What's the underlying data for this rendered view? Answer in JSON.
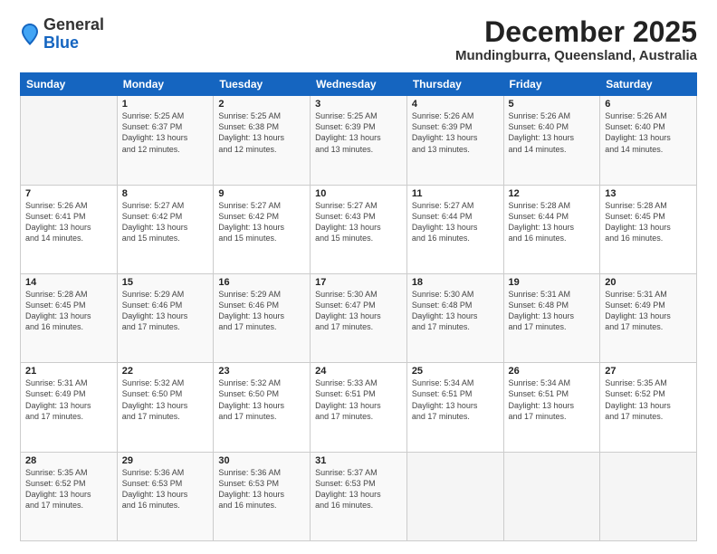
{
  "header": {
    "logo_general": "General",
    "logo_blue": "Blue",
    "month_title": "December 2025",
    "location": "Mundingburra, Queensland, Australia"
  },
  "days_of_week": [
    "Sunday",
    "Monday",
    "Tuesday",
    "Wednesday",
    "Thursday",
    "Friday",
    "Saturday"
  ],
  "weeks": [
    [
      {
        "day": "",
        "info": ""
      },
      {
        "day": "1",
        "info": "Sunrise: 5:25 AM\nSunset: 6:37 PM\nDaylight: 13 hours\nand 12 minutes."
      },
      {
        "day": "2",
        "info": "Sunrise: 5:25 AM\nSunset: 6:38 PM\nDaylight: 13 hours\nand 12 minutes."
      },
      {
        "day": "3",
        "info": "Sunrise: 5:25 AM\nSunset: 6:39 PM\nDaylight: 13 hours\nand 13 minutes."
      },
      {
        "day": "4",
        "info": "Sunrise: 5:26 AM\nSunset: 6:39 PM\nDaylight: 13 hours\nand 13 minutes."
      },
      {
        "day": "5",
        "info": "Sunrise: 5:26 AM\nSunset: 6:40 PM\nDaylight: 13 hours\nand 14 minutes."
      },
      {
        "day": "6",
        "info": "Sunrise: 5:26 AM\nSunset: 6:40 PM\nDaylight: 13 hours\nand 14 minutes."
      }
    ],
    [
      {
        "day": "7",
        "info": "Sunrise: 5:26 AM\nSunset: 6:41 PM\nDaylight: 13 hours\nand 14 minutes."
      },
      {
        "day": "8",
        "info": "Sunrise: 5:27 AM\nSunset: 6:42 PM\nDaylight: 13 hours\nand 15 minutes."
      },
      {
        "day": "9",
        "info": "Sunrise: 5:27 AM\nSunset: 6:42 PM\nDaylight: 13 hours\nand 15 minutes."
      },
      {
        "day": "10",
        "info": "Sunrise: 5:27 AM\nSunset: 6:43 PM\nDaylight: 13 hours\nand 15 minutes."
      },
      {
        "day": "11",
        "info": "Sunrise: 5:27 AM\nSunset: 6:44 PM\nDaylight: 13 hours\nand 16 minutes."
      },
      {
        "day": "12",
        "info": "Sunrise: 5:28 AM\nSunset: 6:44 PM\nDaylight: 13 hours\nand 16 minutes."
      },
      {
        "day": "13",
        "info": "Sunrise: 5:28 AM\nSunset: 6:45 PM\nDaylight: 13 hours\nand 16 minutes."
      }
    ],
    [
      {
        "day": "14",
        "info": "Sunrise: 5:28 AM\nSunset: 6:45 PM\nDaylight: 13 hours\nand 16 minutes."
      },
      {
        "day": "15",
        "info": "Sunrise: 5:29 AM\nSunset: 6:46 PM\nDaylight: 13 hours\nand 17 minutes."
      },
      {
        "day": "16",
        "info": "Sunrise: 5:29 AM\nSunset: 6:46 PM\nDaylight: 13 hours\nand 17 minutes."
      },
      {
        "day": "17",
        "info": "Sunrise: 5:30 AM\nSunset: 6:47 PM\nDaylight: 13 hours\nand 17 minutes."
      },
      {
        "day": "18",
        "info": "Sunrise: 5:30 AM\nSunset: 6:48 PM\nDaylight: 13 hours\nand 17 minutes."
      },
      {
        "day": "19",
        "info": "Sunrise: 5:31 AM\nSunset: 6:48 PM\nDaylight: 13 hours\nand 17 minutes."
      },
      {
        "day": "20",
        "info": "Sunrise: 5:31 AM\nSunset: 6:49 PM\nDaylight: 13 hours\nand 17 minutes."
      }
    ],
    [
      {
        "day": "21",
        "info": "Sunrise: 5:31 AM\nSunset: 6:49 PM\nDaylight: 13 hours\nand 17 minutes."
      },
      {
        "day": "22",
        "info": "Sunrise: 5:32 AM\nSunset: 6:50 PM\nDaylight: 13 hours\nand 17 minutes."
      },
      {
        "day": "23",
        "info": "Sunrise: 5:32 AM\nSunset: 6:50 PM\nDaylight: 13 hours\nand 17 minutes."
      },
      {
        "day": "24",
        "info": "Sunrise: 5:33 AM\nSunset: 6:51 PM\nDaylight: 13 hours\nand 17 minutes."
      },
      {
        "day": "25",
        "info": "Sunrise: 5:34 AM\nSunset: 6:51 PM\nDaylight: 13 hours\nand 17 minutes."
      },
      {
        "day": "26",
        "info": "Sunrise: 5:34 AM\nSunset: 6:51 PM\nDaylight: 13 hours\nand 17 minutes."
      },
      {
        "day": "27",
        "info": "Sunrise: 5:35 AM\nSunset: 6:52 PM\nDaylight: 13 hours\nand 17 minutes."
      }
    ],
    [
      {
        "day": "28",
        "info": "Sunrise: 5:35 AM\nSunset: 6:52 PM\nDaylight: 13 hours\nand 17 minutes."
      },
      {
        "day": "29",
        "info": "Sunrise: 5:36 AM\nSunset: 6:53 PM\nDaylight: 13 hours\nand 16 minutes."
      },
      {
        "day": "30",
        "info": "Sunrise: 5:36 AM\nSunset: 6:53 PM\nDaylight: 13 hours\nand 16 minutes."
      },
      {
        "day": "31",
        "info": "Sunrise: 5:37 AM\nSunset: 6:53 PM\nDaylight: 13 hours\nand 16 minutes."
      },
      {
        "day": "",
        "info": ""
      },
      {
        "day": "",
        "info": ""
      },
      {
        "day": "",
        "info": ""
      }
    ]
  ]
}
